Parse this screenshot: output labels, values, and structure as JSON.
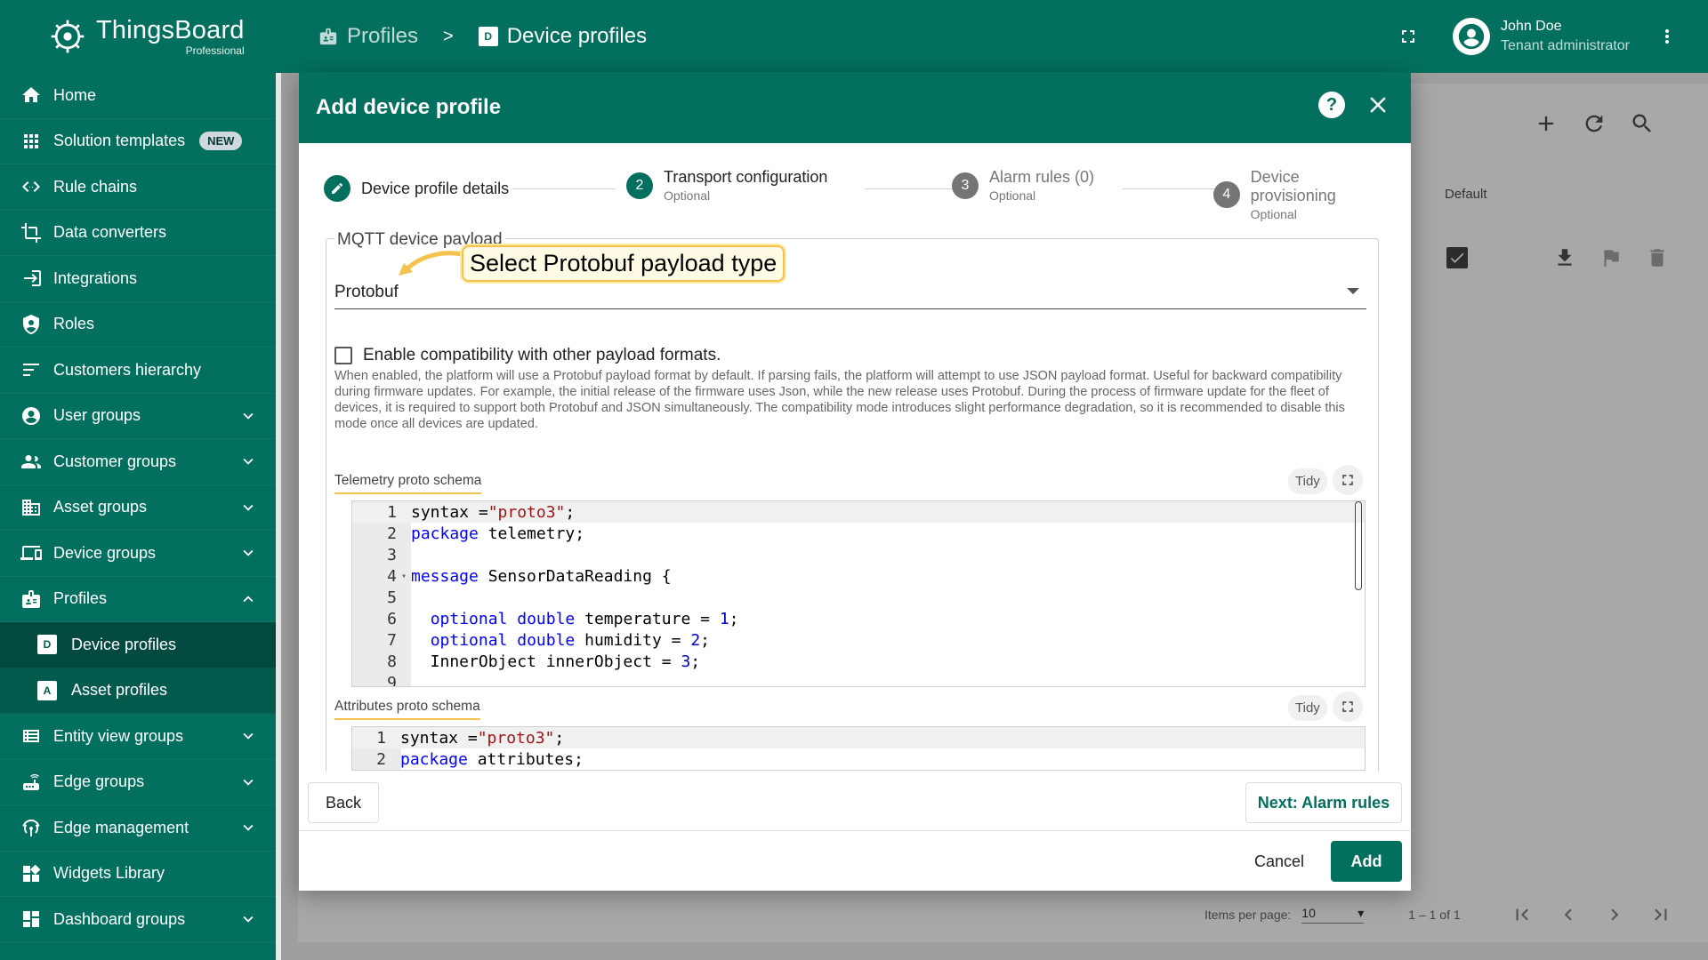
{
  "app": {
    "logo_title": "ThingsBoard",
    "logo_sub": "Professional"
  },
  "sidebar": {
    "items": [
      {
        "label": "Home",
        "icon": "home-icon"
      },
      {
        "label": "Solution templates",
        "icon": "apps-icon",
        "badge": "NEW"
      },
      {
        "label": "Rule chains",
        "icon": "rule-chain-icon"
      },
      {
        "label": "Data converters",
        "icon": "converter-icon"
      },
      {
        "label": "Integrations",
        "icon": "integration-icon"
      },
      {
        "label": "Roles",
        "icon": "shield-icon"
      },
      {
        "label": "Customers hierarchy",
        "icon": "hierarchy-icon"
      },
      {
        "label": "User groups",
        "icon": "user-icon"
      },
      {
        "label": "Customer groups",
        "icon": "group-icon"
      },
      {
        "label": "Asset groups",
        "icon": "domain-icon"
      },
      {
        "label": "Device groups",
        "icon": "devices-icon"
      },
      {
        "label": "Profiles",
        "icon": "badge-icon"
      },
      {
        "label": "Device profiles",
        "icon_letter": "D"
      },
      {
        "label": "Asset profiles",
        "icon_letter": "A"
      },
      {
        "label": "Entity view groups",
        "icon": "view-icon"
      },
      {
        "label": "Edge groups",
        "icon": "router-icon"
      },
      {
        "label": "Edge management",
        "icon": "antenna-icon"
      },
      {
        "label": "Widgets Library",
        "icon": "widgets-icon"
      },
      {
        "label": "Dashboard groups",
        "icon": "dashboard-icon"
      }
    ]
  },
  "topbar": {
    "crumb1": "Profiles",
    "separator": ">",
    "crumb2": "Device profiles",
    "crumb2_letter": "D",
    "user_name": "John Doe",
    "user_role": "Tenant administrator"
  },
  "background": {
    "column_default": "Default",
    "items_per_page_label": "Items per page:",
    "items_per_page_value": "10",
    "range": "1 – 1 of 1"
  },
  "dialog": {
    "title": "Add device profile",
    "steps": [
      {
        "number": "1",
        "label": "Device profile details",
        "optional": ""
      },
      {
        "number": "2",
        "label": "Transport configuration",
        "optional": "Optional"
      },
      {
        "number": "3",
        "label": "Alarm rules (0)",
        "optional": "Optional"
      },
      {
        "number": "4",
        "label": "Device provisioning",
        "optional": "Optional"
      }
    ],
    "fieldset_legend": "MQTT device payload",
    "callout": "Select Protobuf payload type",
    "payload_type": "Protobuf",
    "compat_label": "Enable compatibility with other payload formats.",
    "compat_desc": "When enabled, the platform will use a Protobuf payload format by default. If parsing fails, the platform will attempt to use JSON payload format. Useful for backward compatibility during firmware updates. For example, the initial release of the firmware uses Json, while the new release uses Protobuf. During the process of firmware update for the fleet of devices, it is required to support both Protobuf and JSON simultaneously. The compatibility mode introduces slight performance degradation, so it is recommended to disable this mode once all devices are updated.",
    "telemetry_label": "Telemetry proto schema",
    "attributes_label": "Attributes proto schema",
    "tidy": "Tidy",
    "back": "Back",
    "next": "Next: Alarm rules",
    "cancel": "Cancel",
    "add": "Add",
    "telemetry_lines": [
      {
        "n": "1",
        "text": "syntax =\"proto3\";"
      },
      {
        "n": "2",
        "text": "package telemetry;"
      },
      {
        "n": "3",
        "text": ""
      },
      {
        "n": "4",
        "text": "message SensorDataReading {"
      },
      {
        "n": "5",
        "text": ""
      },
      {
        "n": "6",
        "text": "  optional double temperature = 1;"
      },
      {
        "n": "7",
        "text": "  optional double humidity = 2;"
      },
      {
        "n": "8",
        "text": "  InnerObject innerObject = 3;"
      },
      {
        "n": "9",
        "text": ""
      }
    ],
    "attributes_lines": [
      {
        "n": "1",
        "text": "syntax =\"proto3\";"
      },
      {
        "n": "2",
        "text": "package attributes;"
      }
    ]
  },
  "colors": {
    "brand": "#03705f",
    "callout_border": "#f5c24c"
  }
}
